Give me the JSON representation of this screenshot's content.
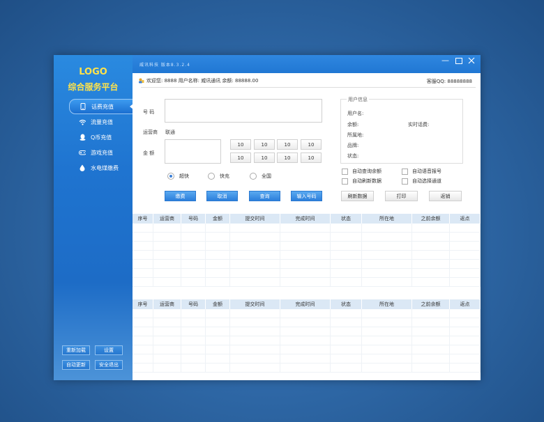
{
  "logo": {
    "line1": "LOGO",
    "line2": "综合服务平台"
  },
  "nav": [
    {
      "label": "话费充值",
      "icon": "phone-icon",
      "active": true
    },
    {
      "label": "流量充值",
      "icon": "wifi-icon"
    },
    {
      "label": "Q币充值",
      "icon": "qq-icon"
    },
    {
      "label": "游戏充值",
      "icon": "gamepad-icon"
    },
    {
      "label": "水电煤缴费",
      "icon": "water-drop-icon"
    }
  ],
  "side_buttons": {
    "reload": "重新加载",
    "settings": "设置",
    "auto_update": "自动更新",
    "safe_exit": "安全退出"
  },
  "titlebar": {
    "text": "威讯科技  版本8.3.2.4"
  },
  "topinfo": {
    "welcome": "欢迎您: 8888  用户名称: 威讯通讯   余额: 88888.00",
    "contact": "客服QQ: 88888888"
  },
  "form": {
    "number_label": "号  码",
    "operator_label": "运营商",
    "operator_value": "联通",
    "amount_label": "金  额",
    "amounts": [
      "10",
      "10",
      "10",
      "10",
      "10",
      "10",
      "10",
      "10"
    ],
    "radios": [
      {
        "label": "超快",
        "checked": true
      },
      {
        "label": "快充",
        "checked": false
      },
      {
        "label": "全国",
        "checked": false
      }
    ]
  },
  "buttons": {
    "pay": "缴费",
    "cancel": "取消",
    "query": "查询",
    "input_number": "输入号码",
    "refresh": "刷新数据",
    "print": "打印",
    "rebate": "返销"
  },
  "user_info": {
    "title": "用户信息",
    "name": "用户名:",
    "balance": "余额:",
    "realtime_fee": "实时话费:",
    "location": "所属地:",
    "brand": "品牌:",
    "status": "状态:"
  },
  "checkboxes": {
    "auto_query_balance": "自动查询余额",
    "auto_voice_report": "自动语音报号",
    "auto_refresh": "自动刷新数据",
    "auto_select_channel": "自动选择通道"
  },
  "table_columns": [
    "序号",
    "运营商",
    "号码",
    "金额",
    "提交时间",
    "完成时间",
    "状态",
    "所在地",
    "之前余额",
    "返点"
  ]
}
